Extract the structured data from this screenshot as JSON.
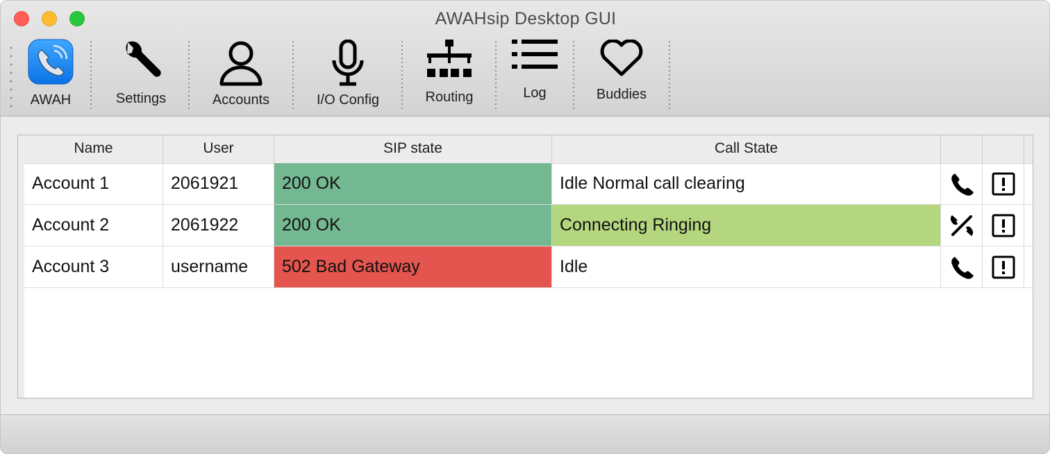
{
  "window": {
    "title": "AWAHsip Desktop GUI"
  },
  "toolbar": {
    "items": [
      {
        "label": "AWAH",
        "icon": "phone-app-icon"
      },
      {
        "label": "Settings",
        "icon": "wrench-icon"
      },
      {
        "label": "Accounts",
        "icon": "user-icon"
      },
      {
        "label": "I/O Config",
        "icon": "microphone-icon"
      },
      {
        "label": "Routing",
        "icon": "sitemap-icon"
      },
      {
        "label": "Log",
        "icon": "list-icon"
      },
      {
        "label": "Buddies",
        "icon": "heart-icon"
      }
    ]
  },
  "table": {
    "columns": [
      "Name",
      "User",
      "SIP state",
      "Call State",
      "",
      ""
    ],
    "rows": [
      {
        "name": "Account 1",
        "user": "2061921",
        "sip_state": "200 OK",
        "call_state": "Idle Normal call clearing",
        "call_icon": "phone-icon",
        "info_icon": "alert-icon"
      },
      {
        "name": "Account 2",
        "user": "2061922",
        "sip_state": "200 OK",
        "call_state": "Connecting Ringing",
        "call_icon": "hangup-icon",
        "info_icon": "alert-icon"
      },
      {
        "name": "Account 3",
        "user": "username",
        "sip_state": "502 Bad Gateway",
        "call_state": "Idle",
        "call_icon": "phone-icon",
        "info_icon": "alert-icon"
      }
    ]
  },
  "colors": {
    "sip_ok": "#74b892",
    "sip_error": "#e4554f",
    "call_ringing": "#b3d67f"
  }
}
